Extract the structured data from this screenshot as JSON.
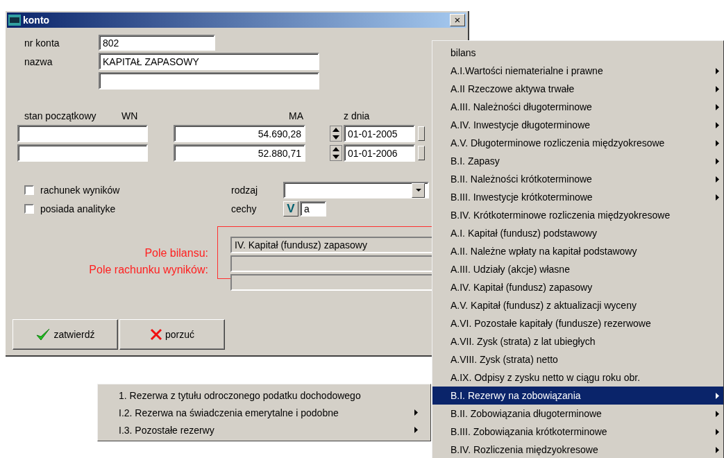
{
  "window": {
    "title": "konto",
    "close_label": "×"
  },
  "account_number": {
    "label": "nr konta",
    "value": "802"
  },
  "account_name": {
    "label": "nazwa",
    "value": "KAPITAŁ ZAPASOWY",
    "extra_line": {
      "kind": "text"
    }
  },
  "opening_balance": {
    "label": "stan początkowy",
    "wn_label": "WN",
    "ma_label": "MA",
    "date_label": "z dnia",
    "rows": [
      {
        "ma": "54.690,28",
        "date": "01-01-2005"
      },
      {
        "ma": "52.880,71",
        "date": "01-01-2006"
      }
    ]
  },
  "checkboxes": [
    {
      "label": "rachunek wyników",
      "checked": false
    },
    {
      "label": "posiada analityke",
      "checked": false
    }
  ],
  "rodzaj": {
    "label": "rodzaj"
  },
  "cechy": {
    "label": "cechy",
    "button_label": "V",
    "value": "a"
  },
  "statement_fields": [
    {
      "label": "Pole bilansu:",
      "value": "IV. Kapitał (fundusz) zapasowy"
    },
    {
      "label": "Pole rachunku wyników:"
    }
  ],
  "buttons": [
    {
      "label": "zatwierdź",
      "kind": "confirm"
    },
    {
      "label": "porzuć",
      "kind": "cancel"
    }
  ],
  "menu": {
    "items": [
      {
        "label": "bilans",
        "has_submenu": false,
        "selected": false
      },
      {
        "label": "A.I.Wartości niematerialne i prawne",
        "has_submenu": true,
        "selected": false
      },
      {
        "label": "A.II Rzeczowe aktywa trwałe",
        "has_submenu": true,
        "selected": false
      },
      {
        "label": "A.III. Należności długoterminowe",
        "has_submenu": true,
        "selected": false
      },
      {
        "label": "A.IV. Inwestycje długoterminowe",
        "has_submenu": true,
        "selected": false
      },
      {
        "label": "A.V. Długoterminowe rozliczenia międzyokresowe",
        "has_submenu": true,
        "selected": false
      },
      {
        "label": "B.I. Zapasy",
        "has_submenu": true,
        "selected": false
      },
      {
        "label": "B.II. Należności krótkoterminowe",
        "has_submenu": true,
        "selected": false
      },
      {
        "label": "B.III. Inwestycje krótkoterminowe",
        "has_submenu": true,
        "selected": false
      },
      {
        "label": "B.IV. Krótkoterminowe rozliczenia międzyokresowe",
        "has_submenu": false,
        "selected": false
      },
      {
        "label": "A.I. Kapitał (fundusz) podstawowy",
        "has_submenu": false,
        "selected": false
      },
      {
        "label": "A.II. Należne wpłaty na kapitał podstawowy",
        "has_submenu": false,
        "selected": false
      },
      {
        "label": "A.III. Udziały (akcje) własne",
        "has_submenu": false,
        "selected": false
      },
      {
        "label": "A.IV. Kapitał (fundusz) zapasowy",
        "has_submenu": false,
        "selected": false
      },
      {
        "label": "A.V. Kapitał (fundusz) z aktualizacji wyceny",
        "has_submenu": false,
        "selected": false
      },
      {
        "label": "A.VI. Pozostałe kapitały (fundusze) rezerwowe",
        "has_submenu": false,
        "selected": false
      },
      {
        "label": "A.VII. Zysk (strata) z lat ubiegłych",
        "has_submenu": false,
        "selected": false
      },
      {
        "label": "A.VIII. Zysk (strata) netto",
        "has_submenu": false,
        "selected": false
      },
      {
        "label": "A.IX. Odpisy z zysku netto w ciągu roku obr.",
        "has_submenu": false,
        "selected": false
      },
      {
        "label": "B.I. Rezerwy na zobowiązania",
        "has_submenu": true,
        "selected": true
      },
      {
        "label": "B.II. Zobowiązania długoterminowe",
        "has_submenu": true,
        "selected": false
      },
      {
        "label": "B.III. Zobowiązania krótkoterminowe",
        "has_submenu": true,
        "selected": false
      },
      {
        "label": "B.IV. Rozliczenia międzyokresowe",
        "has_submenu": true,
        "selected": false
      }
    ]
  },
  "submenu": {
    "items": [
      {
        "label": "1. Rezerwa z tytułu odroczonego podatku dochodowego",
        "has_submenu": false,
        "selected": false
      },
      {
        "label": "I.2. Rezerwa na świadczenia emerytalne i podobne",
        "has_submenu": true,
        "selected": false
      },
      {
        "label": "I.3. Pozostałe rezerwy",
        "has_submenu": true,
        "selected": false
      }
    ]
  }
}
